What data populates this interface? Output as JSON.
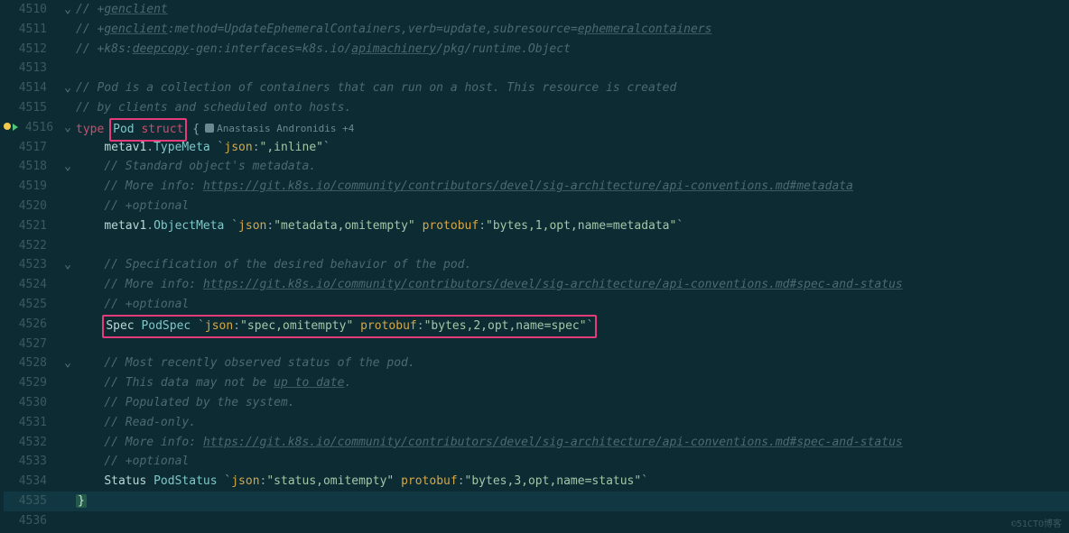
{
  "watermark": "©51CTO博客",
  "author_lens": "Anastasis Andronidis +4",
  "lines": [
    {
      "num": "4510",
      "fold": "⌄",
      "segs": [
        {
          "c": "comment",
          "t": "// +"
        },
        {
          "c": "link",
          "t": "genclient"
        }
      ]
    },
    {
      "num": "4511",
      "fold": "",
      "segs": [
        {
          "c": "comment",
          "t": "// +"
        },
        {
          "c": "link",
          "t": "genclient"
        },
        {
          "c": "comment",
          "t": ":method=UpdateEphemeralContainers,verb=update,subresource="
        },
        {
          "c": "link",
          "t": "ephemeralcontainers"
        }
      ]
    },
    {
      "num": "4512",
      "fold": "",
      "segs": [
        {
          "c": "comment",
          "t": "// +k8s:"
        },
        {
          "c": "link",
          "t": "deepcopy"
        },
        {
          "c": "comment",
          "t": "-gen:interfaces=k8s.io/"
        },
        {
          "c": "link",
          "t": "apimachinery"
        },
        {
          "c": "comment",
          "t": "/pkg/runtime.Object"
        }
      ]
    },
    {
      "num": "4513",
      "fold": "",
      "segs": []
    },
    {
      "num": "4514",
      "fold": "⌄",
      "segs": [
        {
          "c": "comment",
          "t": "// Pod is a collection of containers that can run on a host. This resource is created"
        }
      ]
    },
    {
      "num": "4515",
      "fold": "",
      "segs": [
        {
          "c": "comment",
          "t": "// by clients and scheduled onto hosts."
        }
      ]
    },
    {
      "num": "4516",
      "fold": "⌄",
      "bp": true,
      "segs": [
        {
          "c": "kw",
          "t": "type "
        },
        {
          "c": "box",
          "t": "Pod struct"
        },
        {
          "c": "punct",
          "t": " {"
        },
        {
          "c": "lens",
          "t": ""
        }
      ]
    },
    {
      "num": "4517",
      "fold": "",
      "indent": "    ",
      "segs": [
        {
          "c": "field",
          "t": "metav1"
        },
        {
          "c": "punct",
          "t": "."
        },
        {
          "c": "typename",
          "t": "TypeMeta"
        },
        {
          "c": "punct",
          "t": " `"
        },
        {
          "c": "tagkw",
          "t": "json"
        },
        {
          "c": "punct",
          "t": ":"
        },
        {
          "c": "str",
          "t": "\",inline\""
        },
        {
          "c": "punct",
          "t": "`"
        }
      ]
    },
    {
      "num": "4518",
      "fold": "⌄",
      "indent": "    ",
      "segs": [
        {
          "c": "comment",
          "t": "// Standard object's metadata."
        }
      ]
    },
    {
      "num": "4519",
      "fold": "",
      "indent": "    ",
      "segs": [
        {
          "c": "comment",
          "t": "// More info: "
        },
        {
          "c": "link",
          "t": "https://git.k8s.io/community/contributors/devel/sig-architecture/api-conventions.md#metadata"
        }
      ]
    },
    {
      "num": "4520",
      "fold": "",
      "indent": "    ",
      "segs": [
        {
          "c": "comment",
          "t": "// +optional"
        }
      ]
    },
    {
      "num": "4521",
      "fold": "",
      "indent": "    ",
      "segs": [
        {
          "c": "field",
          "t": "metav1"
        },
        {
          "c": "punct",
          "t": "."
        },
        {
          "c": "typename",
          "t": "ObjectMeta"
        },
        {
          "c": "punct",
          "t": " `"
        },
        {
          "c": "tagkw",
          "t": "json"
        },
        {
          "c": "punct",
          "t": ":"
        },
        {
          "c": "str",
          "t": "\"metadata,omitempty\""
        },
        {
          "c": "punct",
          "t": " "
        },
        {
          "c": "tagkw",
          "t": "protobuf"
        },
        {
          "c": "punct",
          "t": ":"
        },
        {
          "c": "str",
          "t": "\"bytes,1,opt,name=metadata\""
        },
        {
          "c": "punct",
          "t": "`"
        }
      ]
    },
    {
      "num": "4522",
      "fold": "",
      "segs": []
    },
    {
      "num": "4523",
      "fold": "⌄",
      "indent": "    ",
      "segs": [
        {
          "c": "comment",
          "t": "// Specification of the desired behavior of the pod."
        }
      ]
    },
    {
      "num": "4524",
      "fold": "",
      "indent": "    ",
      "segs": [
        {
          "c": "comment",
          "t": "// More info: "
        },
        {
          "c": "link",
          "t": "https://git.k8s.io/community/contributors/devel/sig-architecture/api-conventions.md#spec-and-status"
        }
      ]
    },
    {
      "num": "4525",
      "fold": "",
      "indent": "    ",
      "segs": [
        {
          "c": "comment",
          "t": "// +optional"
        }
      ]
    },
    {
      "num": "4526",
      "fold": "",
      "indent": "    ",
      "box_full": true,
      "segs": [
        {
          "c": "field",
          "t": "Spec"
        },
        {
          "c": "punct",
          "t": " "
        },
        {
          "c": "typename",
          "t": "PodSpec"
        },
        {
          "c": "punct",
          "t": " `"
        },
        {
          "c": "tagkw",
          "t": "json"
        },
        {
          "c": "punct",
          "t": ":"
        },
        {
          "c": "str",
          "t": "\"spec,omitempty\""
        },
        {
          "c": "punct",
          "t": " "
        },
        {
          "c": "tagkw",
          "t": "protobuf"
        },
        {
          "c": "punct",
          "t": ":"
        },
        {
          "c": "str",
          "t": "\"bytes,2,opt,name=spec\""
        },
        {
          "c": "punct",
          "t": "`"
        }
      ]
    },
    {
      "num": "4527",
      "fold": "",
      "segs": []
    },
    {
      "num": "4528",
      "fold": "⌄",
      "indent": "    ",
      "segs": [
        {
          "c": "comment",
          "t": "// Most recently observed status of the pod."
        }
      ]
    },
    {
      "num": "4529",
      "fold": "",
      "indent": "    ",
      "segs": [
        {
          "c": "comment",
          "t": "// This data may not be "
        },
        {
          "c": "link",
          "t": "up to date"
        },
        {
          "c": "comment",
          "t": "."
        }
      ]
    },
    {
      "num": "4530",
      "fold": "",
      "indent": "    ",
      "segs": [
        {
          "c": "comment",
          "t": "// Populated by the system."
        }
      ]
    },
    {
      "num": "4531",
      "fold": "",
      "indent": "    ",
      "segs": [
        {
          "c": "comment",
          "t": "// Read-only."
        }
      ]
    },
    {
      "num": "4532",
      "fold": "",
      "indent": "    ",
      "segs": [
        {
          "c": "comment",
          "t": "// More info: "
        },
        {
          "c": "link",
          "t": "https://git.k8s.io/community/contributors/devel/sig-architecture/api-conventions.md#spec-and-status"
        }
      ]
    },
    {
      "num": "4533",
      "fold": "",
      "indent": "    ",
      "segs": [
        {
          "c": "comment",
          "t": "// +optional"
        }
      ]
    },
    {
      "num": "4534",
      "fold": "",
      "indent": "    ",
      "segs": [
        {
          "c": "field",
          "t": "Status"
        },
        {
          "c": "punct",
          "t": " "
        },
        {
          "c": "typename",
          "t": "PodStatus"
        },
        {
          "c": "punct",
          "t": " `"
        },
        {
          "c": "tagkw",
          "t": "json"
        },
        {
          "c": "punct",
          "t": ":"
        },
        {
          "c": "str",
          "t": "\"status,omitempty\""
        },
        {
          "c": "punct",
          "t": " "
        },
        {
          "c": "tagkw",
          "t": "protobuf"
        },
        {
          "c": "punct",
          "t": ":"
        },
        {
          "c": "str",
          "t": "\"bytes,3,opt,name=status\""
        },
        {
          "c": "punct",
          "t": "`"
        }
      ]
    },
    {
      "num": "4535",
      "fold": "",
      "hl": true,
      "segs": [
        {
          "c": "brace",
          "t": "}"
        }
      ]
    },
    {
      "num": "4536",
      "fold": "",
      "segs": []
    }
  ]
}
